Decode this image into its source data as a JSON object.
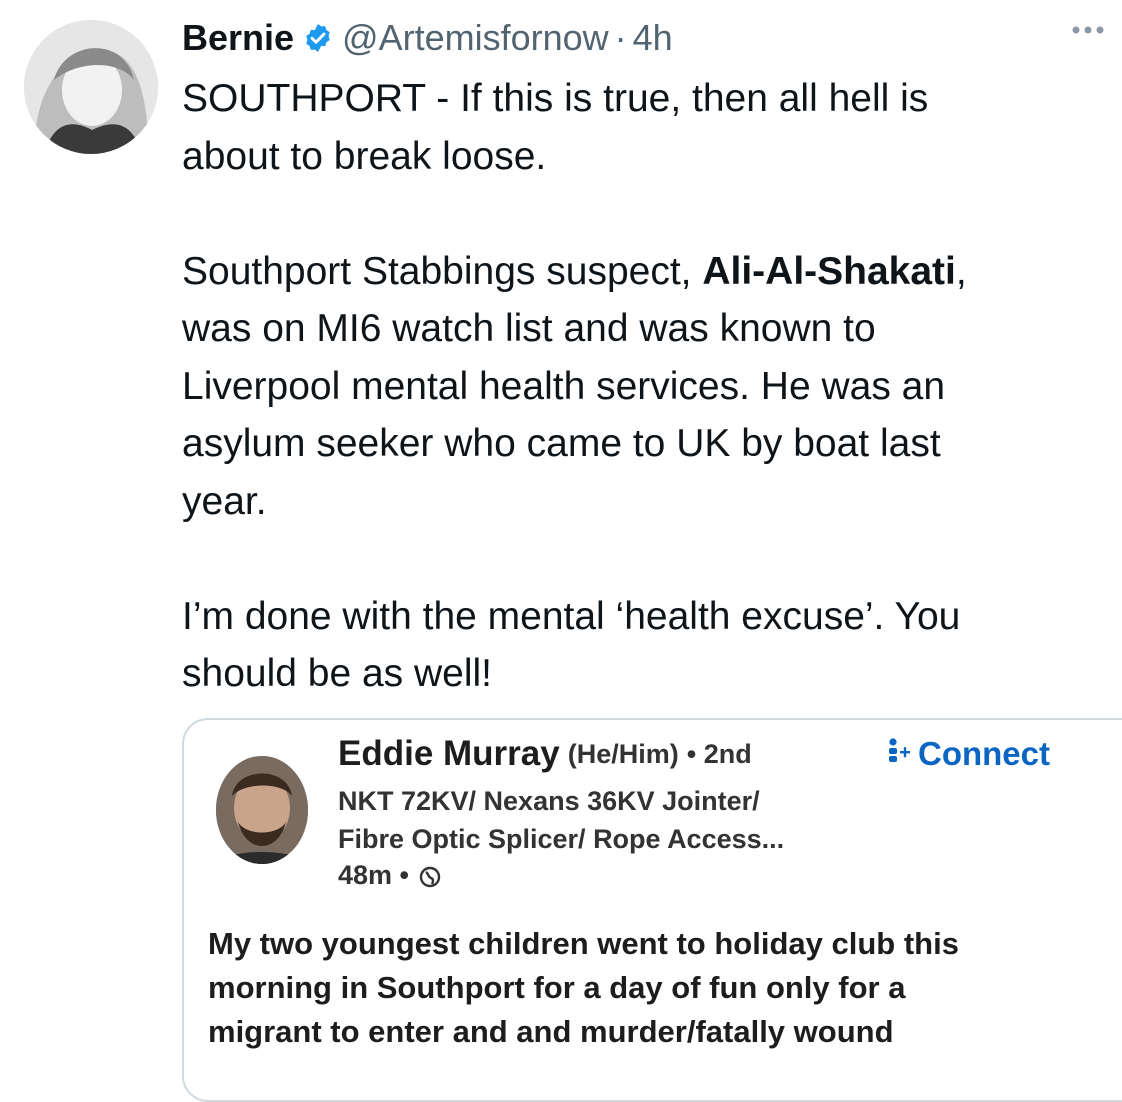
{
  "tweet": {
    "author_name": "Bernie",
    "handle": "@Artemisfornow",
    "separator": "·",
    "time": "4h",
    "lines": [
      "SOUTHPORT - If this is true, then all hell is",
      "about to break loose."
    ],
    "para2_line1_before": "Southport Stabbings suspect, ",
    "para2_line1_bold": "Ali-Al-Shakati",
    "para2_line1_after": ",",
    "para2_lines": [
      "was on MI6 watch list and was known to",
      "Liverpool mental health services. He was an",
      "asylum seeker  who came  to UK by boat last",
      "year."
    ],
    "para3_lines": [
      "I’m done with the mental ‘health excuse’. You",
      "should be as well!"
    ]
  },
  "quoted_post": {
    "name": "Eddie Murray",
    "pronouns": "(He/Him)",
    "degree": "• 2nd",
    "connect_label": "Connect",
    "headline_lines": [
      "NKT 72KV/ Nexans 36KV Jointer/",
      "Fibre Optic Splicer/ Rope Access..."
    ],
    "time": "48m •",
    "body_lines": [
      "My two youngest children went to holiday club this",
      "morning in Southport  for a day of fun only for a",
      "migrant to enter and and murder/fatally wound"
    ]
  },
  "icons": {
    "verified": "verified-badge-icon",
    "more": "more-dots-icon",
    "connect": "connect-person-icon",
    "globe": "globe-icon"
  },
  "colors": {
    "verified_blue": "#1d9bf0",
    "linkedin_blue": "#0a66c2",
    "secondary_text": "#536471"
  }
}
